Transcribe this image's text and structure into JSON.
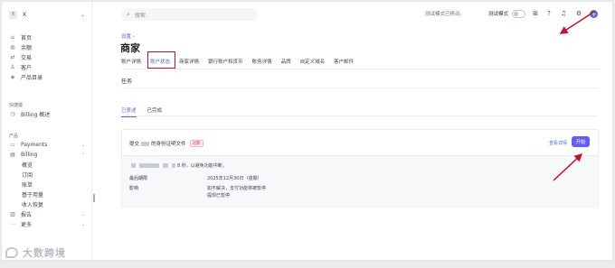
{
  "sidebar": {
    "account": {
      "badge": "X",
      "name": "X"
    },
    "items": [
      {
        "label": "首页",
        "icon": "home-icon"
      },
      {
        "label": "余额",
        "icon": "balance-icon"
      },
      {
        "label": "交易",
        "icon": "transactions-icon"
      },
      {
        "label": "客户",
        "icon": "customers-icon"
      },
      {
        "label": "产品目录",
        "icon": "product-catalog-icon"
      }
    ],
    "shortcuts_heading": "快捷键",
    "shortcut_item": {
      "label": "Billing 概述",
      "icon": "clock-icon"
    },
    "products_heading": "产品",
    "payments": {
      "label": "Payments",
      "icon": "payments-icon"
    },
    "billing": {
      "label": "Billing",
      "icon": "billing-icon"
    },
    "billing_sub": [
      "概览",
      "订阅",
      "账单",
      "基于用量",
      "收入恢复"
    ],
    "reports": {
      "label": "报告",
      "icon": "reports-icon"
    },
    "more": {
      "label": "更多",
      "icon": "more-icon"
    }
  },
  "watermark": {
    "text": "大数跨境"
  },
  "topbar": {
    "search_placeholder": "搜索",
    "test_mode_text": "测试模式已移动。",
    "test_mode_label": "测试模式"
  },
  "page": {
    "breadcrumb": "设置",
    "breadcrumb_sep": "›",
    "title": "商家",
    "tabs": [
      "账户详情",
      "账户状态",
      "商家详情",
      "银行账户和货币",
      "账务详情",
      "品牌",
      "自定义域名",
      "客户邮件"
    ],
    "active_tab": "账户状态",
    "tasks_title": "任务",
    "subtabs": [
      "已表述",
      "已完成"
    ],
    "active_subtab": "已表述"
  },
  "task_card": {
    "title_prefix": "提交",
    "title_suffix": "的身份证明文件",
    "badge": "过期",
    "view_details": "查看详情",
    "start_button": "开始",
    "desc_tail": "8 秒，以避免功能中断。",
    "deadline_label": "最后期限",
    "deadline_value": "2025年12月30日（逾期）",
    "impact_label": "影响",
    "impact_line1": "如不解决，支付功能将被暂停",
    "impact_line2": "提现已暂停"
  },
  "colors": {
    "accent": "#5469d4",
    "primary_button": "#635bff",
    "annotation_red": "#c8102e",
    "overdue_red": "#df1b41"
  }
}
